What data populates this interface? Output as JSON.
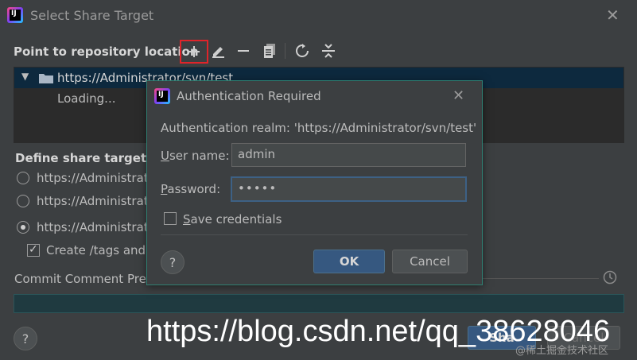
{
  "window": {
    "title": "Select Share Target"
  },
  "repo_section": {
    "label": "Point to repository location"
  },
  "tree": {
    "items": [
      {
        "label": "https://Administrator/svn/test"
      },
      {
        "label": "Loading..."
      }
    ]
  },
  "share_target": {
    "label": "Define share target",
    "options": [
      {
        "label": "https://Administrat"
      },
      {
        "label": "https://Administrat"
      },
      {
        "label": "https://Administrat"
      }
    ],
    "create_tags_label": "Create /tags and /"
  },
  "commit": {
    "label": "Commit Comment Pref"
  },
  "footer": {
    "help_label": "?",
    "share_label": "Sha",
    "share_tail": "Cancel"
  },
  "dialog": {
    "title": "Authentication Required",
    "realm": "Authentication realm: 'https://Administrator/svn/test'",
    "username_label_u": "U",
    "username_label_rest": "ser name:",
    "username_value": "admin",
    "password_label_u": "P",
    "password_label_rest": "assword:",
    "password_value": "•••••",
    "save_u": "S",
    "save_rest": "ave credentials",
    "help_label": "?",
    "ok_label": "OK",
    "cancel_label": "Cancel"
  },
  "watermark": {
    "text": "https://blog.csdn.net/qq_38628046",
    "sub": "@稀土掘金技术社区"
  }
}
